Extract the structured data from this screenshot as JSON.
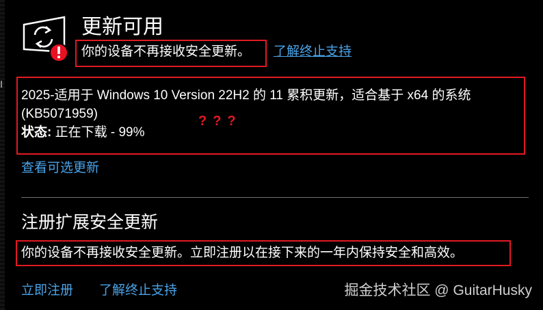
{
  "header": {
    "title": "更新可用",
    "eos_notice": "你的设备不再接收安全更新。",
    "eos_link": "了解终止支持"
  },
  "update": {
    "name_line1": "2025-适用于 Windows 10 Version 22H2 的 11 累积更新，适合基于 x64 的系统",
    "name_line2": "(KB5071959)",
    "status_label": "状态:",
    "status_value": " 正在下载 - 99%",
    "progress_percent": 99
  },
  "annotation": {
    "question_marks": "???"
  },
  "view_optional_link": "查看可选更新",
  "esu": {
    "title": "注册扩展安全更新",
    "description": "你的设备不再接收安全更新。立即注册以在接下来的一年内保持安全和高效。",
    "enroll_link": "立即注册",
    "eos_link": "了解终止支持"
  },
  "watermark": "掘金技术社区 @ GuitarHusky",
  "icons": {
    "status": "update-sync-icon",
    "alert": "error-badge-icon"
  },
  "colors": {
    "background": "#000000",
    "link": "#4aa3e8",
    "highlight_box": "#e21a22",
    "alert_badge": "#e81123"
  }
}
